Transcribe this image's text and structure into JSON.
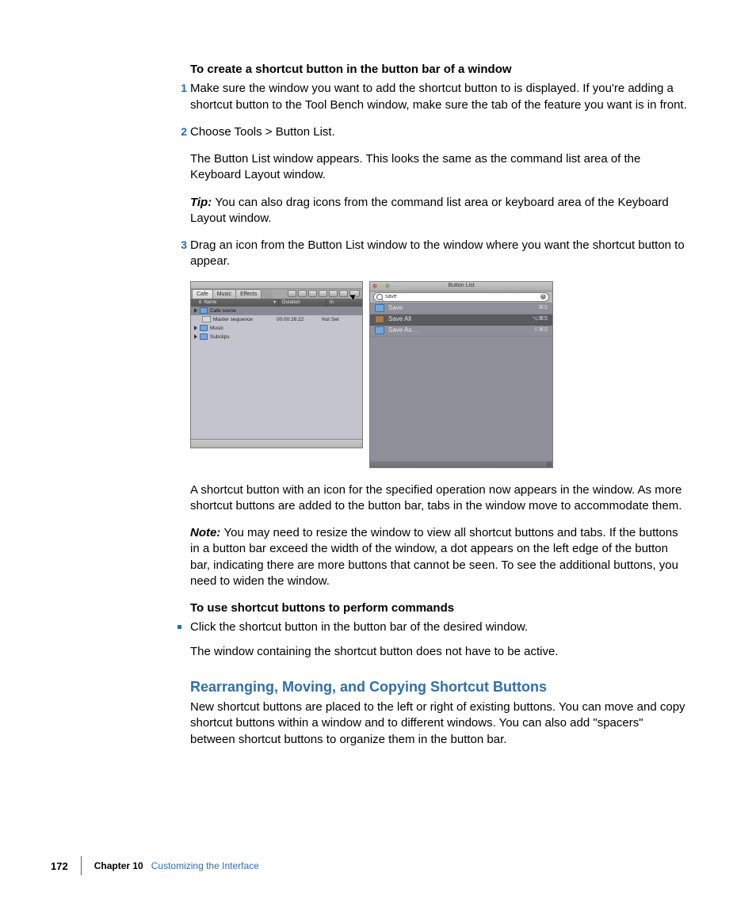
{
  "footer": {
    "page": "172",
    "chapter_label": "Chapter 10",
    "chapter_title": "Customizing the Interface"
  },
  "headings": {
    "create": "To create a shortcut button in the button bar of a window",
    "use": "To use shortcut buttons to perform commands",
    "rearrange": "Rearranging, Moving, and Copying Shortcut Buttons"
  },
  "steps": {
    "s1": "Make sure the window you want to add the shortcut button to is displayed. If you're adding a shortcut button to the Tool Bench window, make sure the tab of the feature you want is in front.",
    "s2": "Choose Tools > Button List.",
    "s2_after": "The Button List window appears. This looks the same as the command list area of the Keyboard Layout window.",
    "tip_label": "Tip:  ",
    "tip": "You can also drag icons from the command list area or keyboard area of the Keyboard Layout window.",
    "s3": "Drag an icon from the Button List window to the window where you want the shortcut button to appear.",
    "result": "A shortcut button with an icon for the specified operation now appears in the window. As more shortcut buttons are added to the button bar, tabs in the window move to accommodate them.",
    "note_label": "Note:  ",
    "note": "You may need to resize the window to view all shortcut buttons and tabs. If the buttons in a button bar exceed the width of the window, a dot appears on the left edge of the button bar, indicating there are more buttons that cannot be seen. To see the additional buttons, you need to widen the window.",
    "use_bullet": "Click the shortcut button in the button bar of the desired window.",
    "use_after": "The window containing the shortcut button does not have to be active.",
    "rearrange_body": "New shortcut buttons are placed to the left or right of existing buttons. You can move and copy shortcut buttons within a window and to different windows. You can also add \"spacers\" between shortcut buttons to organize them in the button bar."
  },
  "nums": {
    "n1": "1",
    "n2": "2",
    "n3": "3"
  },
  "browser": {
    "tabs": [
      "Cafe",
      "Music",
      "Effects"
    ],
    "cols": {
      "name": "Name",
      "duration": "Duration",
      "in": "In"
    },
    "rows": [
      {
        "name": "Cafe scene",
        "type": "bin",
        "dur": "",
        "in": ""
      },
      {
        "name": "Master sequence",
        "type": "seq",
        "dur": "00:00:26:22",
        "in": "Not Set"
      },
      {
        "name": "Music",
        "type": "bin",
        "dur": "",
        "in": ""
      },
      {
        "name": "Subclips",
        "type": "bin",
        "dur": "",
        "in": ""
      }
    ]
  },
  "buttonlist": {
    "title": "Button List",
    "search": "save",
    "rows": [
      {
        "label": "Save",
        "shortcut": "⌘S"
      },
      {
        "label": "Save All",
        "shortcut": "⌥⌘S"
      },
      {
        "label": "Save As…",
        "shortcut": "⇧⌘S"
      }
    ]
  }
}
